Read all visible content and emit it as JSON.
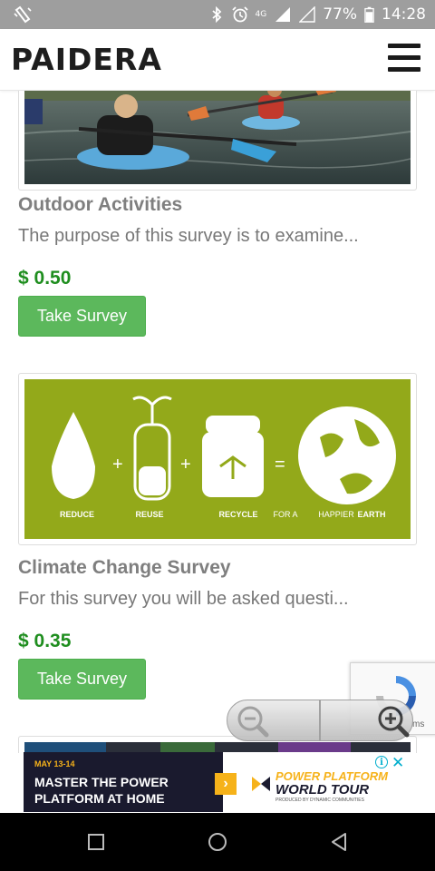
{
  "status_bar": {
    "network": "4G",
    "battery": "77%",
    "time": "14:28"
  },
  "header": {
    "brand": "PAIDERA"
  },
  "surveys": [
    {
      "title": "Outdoor Activities",
      "description": "The purpose of this survey is to examine...",
      "price": "$ 0.50",
      "button_label": "Take Survey"
    },
    {
      "title": "Climate Change Survey",
      "description": "For this survey you will be asked questi...",
      "price": "$ 0.35",
      "button_label": "Take Survey",
      "image_labels": {
        "reduce": "REDUCE",
        "reuse": "REUSE",
        "recycle": "RECYCLE",
        "for_a": "FOR A",
        "happier": "HAPPIER",
        "earth": "EARTH"
      }
    }
  ],
  "recaptcha": {
    "terms_fragment": "ms"
  },
  "ad": {
    "date": "MAY 13-14",
    "headline": "MASTER THE POWER PLATFORM AT HOME",
    "logo_line1": "POWER PLATFORM",
    "logo_line2": "WORLD TOUR",
    "logo_line3": "PRODUCED BY DYNAMIC COMMUNITIES"
  },
  "colors": {
    "status_bar": "#9e9e9e",
    "price_green": "#1f8e1f",
    "button_green": "#5cb85c",
    "climate_image_bg": "#93a91a",
    "ad_gold": "#f6b21a",
    "ad_navy": "#1a1a2e"
  },
  "icons": {
    "status_left": "vibrate-icon",
    "bluetooth": "bluetooth-icon",
    "alarm": "alarm-icon",
    "signal": "signal-icon",
    "battery": "battery-icon",
    "menu": "hamburger-menu-icon",
    "zoom_out": "zoom-out-icon",
    "zoom_in": "zoom-in-icon",
    "back": "nav-back-icon",
    "home": "nav-home-icon",
    "recents": "nav-recents-icon"
  }
}
